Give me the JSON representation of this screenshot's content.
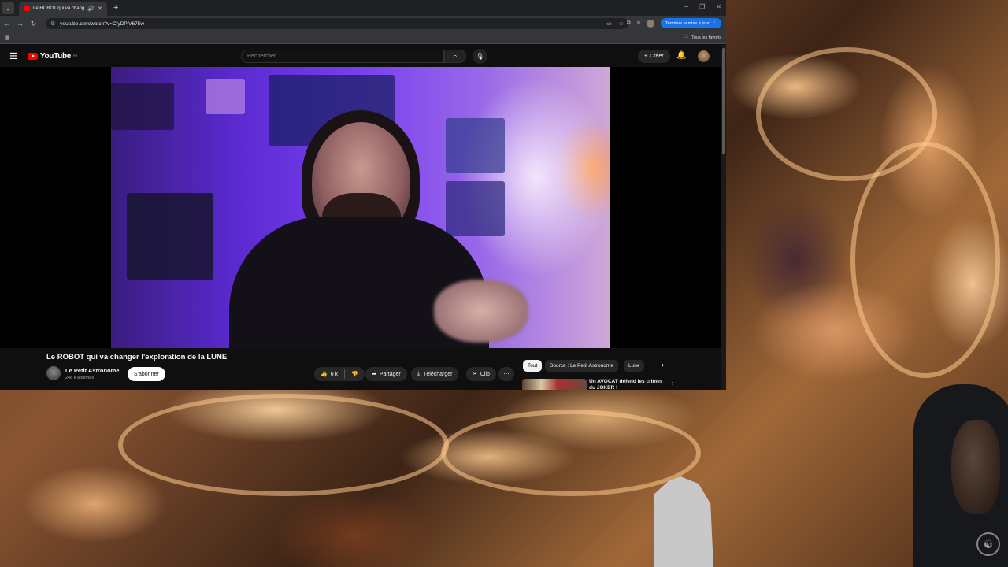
{
  "browser": {
    "tab": {
      "title": "Le ROBOT qui va changer l'",
      "favicon": "youtube-favicon"
    },
    "url": "youtube.com/watch?v=CfyDPjV675w",
    "update_button": "Terminer la mise à jour",
    "bookmarks_label": "Tous les favoris"
  },
  "youtube": {
    "logo_text": "YouTube",
    "logo_country": "FR",
    "search_placeholder": "Rechercher",
    "create_label": "Créer"
  },
  "video": {
    "title": "Le ROBOT qui va changer l'exploration de la LUNE",
    "channel": "Le Petit Astronome",
    "subscribers": "248 k abonnés",
    "subscribe_label": "S'abonner",
    "likes": "6 k",
    "share_label": "Partager",
    "download_label": "Télécharger",
    "clip_label": "Clip"
  },
  "chips": [
    "Tout",
    "Source : Le Petit Astronome",
    "Lune"
  ],
  "recommendation": {
    "title": "Un AVOCAT défend les crimes du JOKER !"
  },
  "colors": {
    "youtube_red": "#ff0000",
    "chrome_blue": "#1a73e8",
    "yt_bg": "#0f0f0f"
  }
}
